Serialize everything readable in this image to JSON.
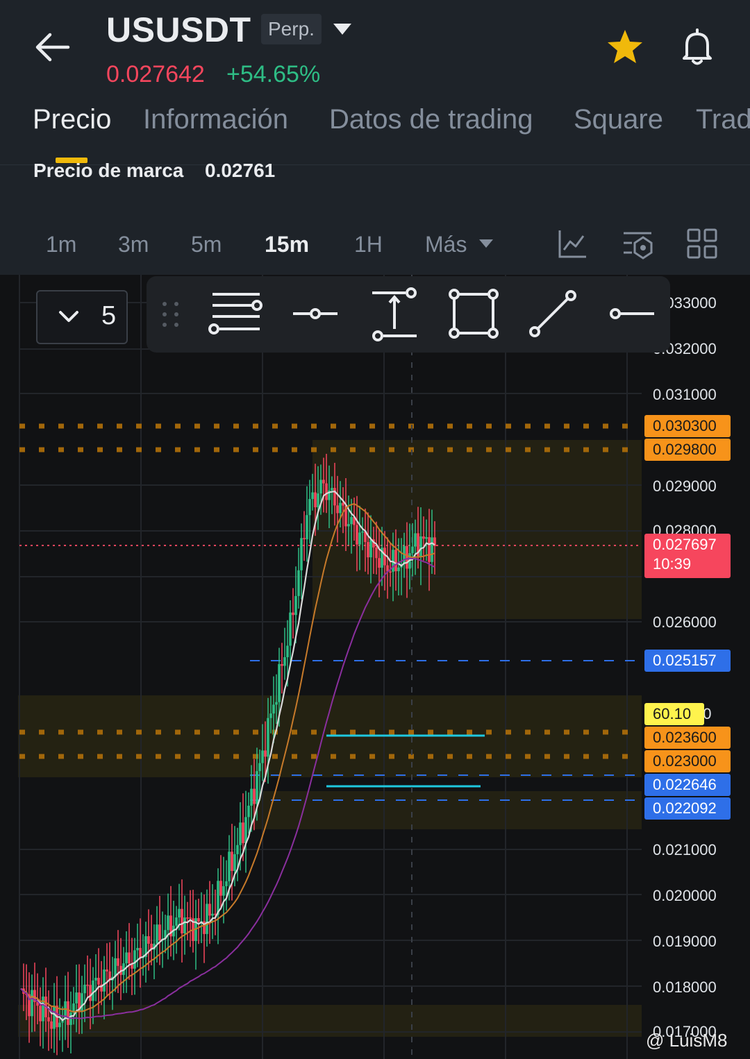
{
  "header": {
    "symbol": "USUSDT",
    "contract_type": "Perp.",
    "last_price": "0.027642",
    "change_pct": "+54.65%",
    "favorited": true
  },
  "tabs": [
    "Precio",
    "Información",
    "Datos de trading",
    "Square",
    "Trad"
  ],
  "active_tab": "Precio",
  "mark_price": {
    "label": "Precio de marca",
    "value": "0.02761"
  },
  "intervals": [
    "1m",
    "3m",
    "5m",
    "15m",
    "1H",
    "Más"
  ],
  "active_interval": "15m",
  "toolbar_icons": [
    "indicators-icon",
    "chart-settings-icon",
    "layout-grid-icon"
  ],
  "drawing_toolbar": {
    "count": "5",
    "tools": [
      "drag-handle-icon",
      "fib-retracement-icon",
      "horizontal-ray-icon",
      "price-range-icon",
      "rectangle-icon",
      "trend-line-icon",
      "horizontal-line-icon"
    ]
  },
  "price_axis": [
    "0.033000",
    "0.032000",
    "0.031000",
    "0.029000",
    "0.028000",
    "0.027000",
    "0.026000",
    "0.024000",
    "0.021000",
    "0.020000",
    "0.019000",
    "0.018000",
    "0.017000"
  ],
  "price_tags": [
    {
      "value": "0.030300",
      "color": "#f7931a"
    },
    {
      "value": "0.029800",
      "color": "#f7931a"
    },
    {
      "value": "0.025157",
      "color": "#2e6fe8"
    },
    {
      "value": "0.023600",
      "color": "#f7931a"
    },
    {
      "value": "0.023000",
      "color": "#f7931a"
    },
    {
      "value": "0.022646",
      "color": "#2e6fe8"
    },
    {
      "value": "0.022092",
      "color": "#2e6fe8"
    }
  ],
  "current_price_tag": {
    "value": "0.027697",
    "countdown": "10:39",
    "color": "#f6465d"
  },
  "indicator_tag": {
    "value": "60.10",
    "color": "#fff34d"
  },
  "watermark": "@ LuisM8",
  "colors": {
    "up": "#2ebd85",
    "down": "#f6465d",
    "accent": "#f0b90b"
  },
  "chart_data": {
    "type": "line",
    "x_axis": "time (15m candles)",
    "series": [
      {
        "values": [
          0.0178,
          0.0176,
          0.0172,
          0.0174,
          0.0179,
          0.0181,
          0.0184,
          0.0186,
          0.0189,
          0.0192,
          0.0195,
          0.0193,
          0.0196,
          0.0205,
          0.0215,
          0.0228,
          0.0244,
          0.026,
          0.0285,
          0.029,
          0.0285,
          0.028,
          0.0276,
          0.0272,
          0.0273,
          0.0278,
          0.0276
        ]
      }
    ],
    "ylim": [
      0.017,
      0.0335
    ]
  }
}
